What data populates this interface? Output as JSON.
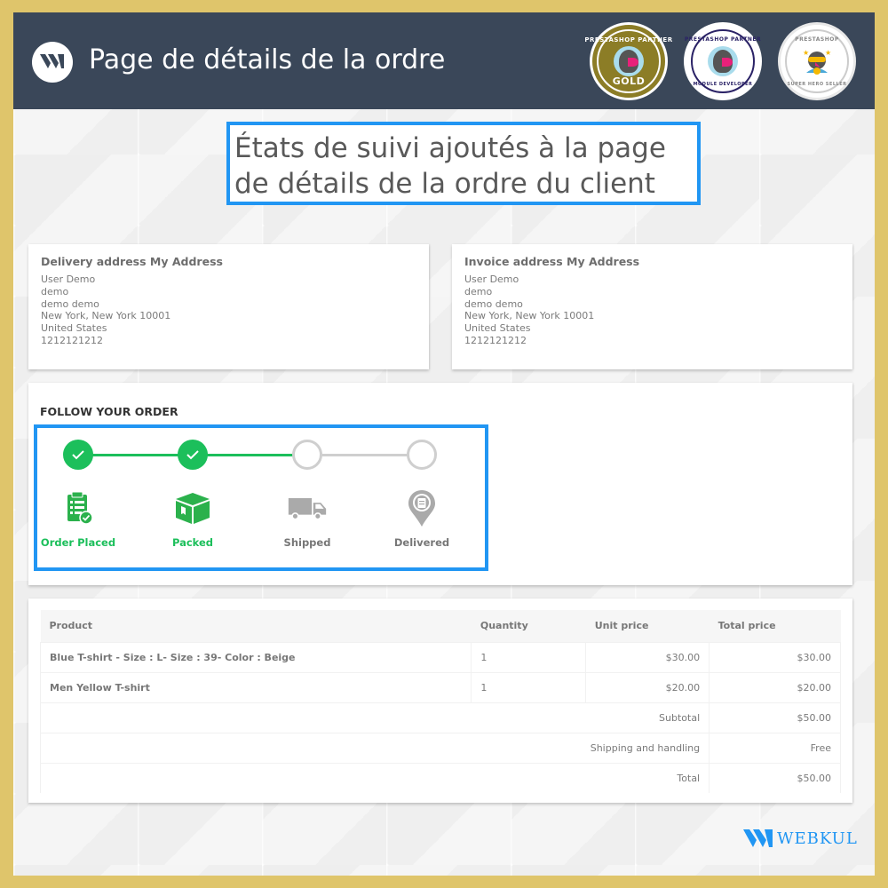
{
  "header": {
    "title": "Page de détails de la ordre",
    "logo_icon": "webkul-logo-icon",
    "badges": [
      {
        "top": "PRESTASHOP PARTNER",
        "bottom": "GOLD",
        "color": "#8c7d26"
      },
      {
        "top": "PRESTASHOP PARTNER",
        "bottom": "MODULE DEVELOPER",
        "color": "#2a2266"
      },
      {
        "top": "PRESTASHOP",
        "bottom": "SUPER HERO SELLER",
        "color": "#888888"
      }
    ]
  },
  "callout": {
    "text_line1": "États de suivi ajoutés à la page",
    "text_line2": "de détails de la ordre du client"
  },
  "delivery_address": {
    "title": "Delivery address My Address",
    "lines": [
      "User Demo",
      "demo",
      "demo demo",
      "New York, New York 10001",
      "United States",
      "1212121212"
    ]
  },
  "invoice_address": {
    "title": "Invoice address My Address",
    "lines": [
      "User Demo",
      "demo",
      "demo demo",
      "New York, New York 10001",
      "United States",
      "1212121212"
    ]
  },
  "follow": {
    "title": "FOLLOW YOUR ORDER",
    "steps": [
      {
        "label": "Order Placed",
        "status": "done",
        "icon": "clipboard-check-icon"
      },
      {
        "label": "Packed",
        "status": "done",
        "icon": "box-icon"
      },
      {
        "label": "Shipped",
        "status": "pending",
        "icon": "truck-icon"
      },
      {
        "label": "Delivered",
        "status": "pending",
        "icon": "location-pin-icon"
      }
    ],
    "colors": {
      "done": "#1cbf5b",
      "pending": "#cfcfcf"
    }
  },
  "order_table": {
    "headers": [
      "Product",
      "Quantity",
      "Unit price",
      "Total price"
    ],
    "rows": [
      {
        "product": "Blue T-shirt - Size : L- Size : 39- Color : Beige",
        "quantity": "1",
        "unit_price": "$30.00",
        "total_price": "$30.00"
      },
      {
        "product": "Men Yellow T-shirt",
        "quantity": "1",
        "unit_price": "$20.00",
        "total_price": "$20.00"
      }
    ],
    "summary": [
      {
        "label": "Subtotal",
        "value": "$50.00"
      },
      {
        "label": "Shipping and handling",
        "value": "Free"
      },
      {
        "label": "Total",
        "value": "$50.00"
      }
    ]
  },
  "footer": {
    "brand": "WEBKUL"
  },
  "colors": {
    "border_gold": "#dfc56b",
    "header_bg": "#3a4759",
    "accent_blue": "#2196f3",
    "success_green": "#1cbf5b"
  }
}
